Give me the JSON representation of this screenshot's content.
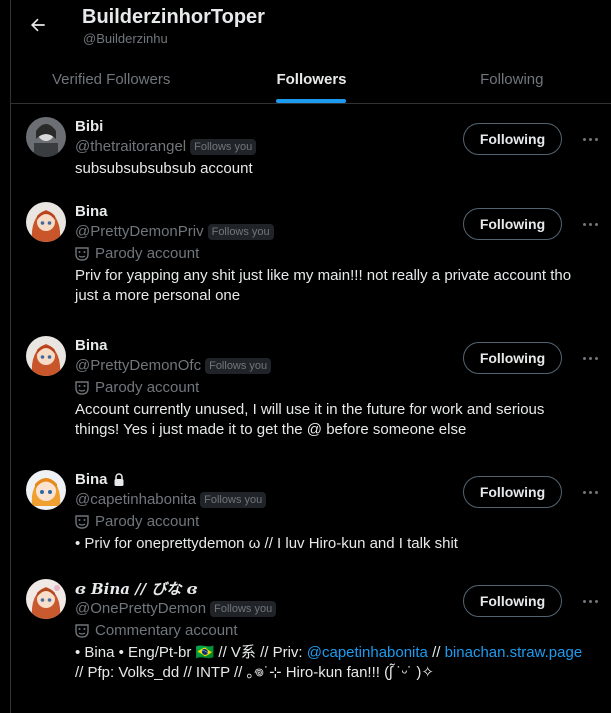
{
  "header": {
    "title": "BuilderzinhorToper",
    "subtitle": "@Builderzinhu",
    "back_icon": "arrow-left-icon"
  },
  "tabs": [
    {
      "label": "Verified Followers",
      "active": false
    },
    {
      "label": "Followers",
      "active": true
    },
    {
      "label": "Following",
      "active": false
    }
  ],
  "accent_color": "#1d9bf0",
  "users": [
    {
      "name": "Bibi",
      "handle": "@thetraitorangel",
      "follows_you": "Follows you",
      "button": "Following",
      "bio": "subsubsubsubsub account"
    },
    {
      "name": "Bina",
      "handle": "@PrettyDemonPriv",
      "follows_you": "Follows you",
      "account_label": "Parody account",
      "button": "Following",
      "bio": "Priv for yapping any shit just like my main!!! not really a private account tho just a more personal one"
    },
    {
      "name": "Bina",
      "handle": "@PrettyDemonOfc",
      "follows_you": "Follows you",
      "account_label": "Parody account",
      "button": "Following",
      "bio": "Account currently unused, I will use it in the future for work and serious things! Yes i just made it to get the @ before someone else"
    },
    {
      "name": "Bina",
      "handle": "@capetinhabonita",
      "follows_you": "Follows you",
      "account_label": "Parody account",
      "button": "Following",
      "bio": "• Priv for oneprettydemon   ω   // I luv Hiro-kun and I talk shit"
    },
    {
      "name": "ɞ 𝑩𝒊𝒏𝒂 // びな ɞ",
      "handle": "@OnePrettyDemon",
      "follows_you": "Follows you",
      "account_label": "Commentary account",
      "button": "Following",
      "bio_parts": {
        "p1": "• Bina • Eng/Pt-br 🇧🇷 // V系 // Priv: ",
        "link1": "@capetinhabonita",
        "p2": " // ",
        "link2": "binachan.straw.page",
        "p3": " // Pfp: Volks_dd // INTP // ｡𖦹˙⊹      Hiro-kun fan!!! (ʃ̃ ˙ᵕ˙ )✧"
      }
    }
  ]
}
